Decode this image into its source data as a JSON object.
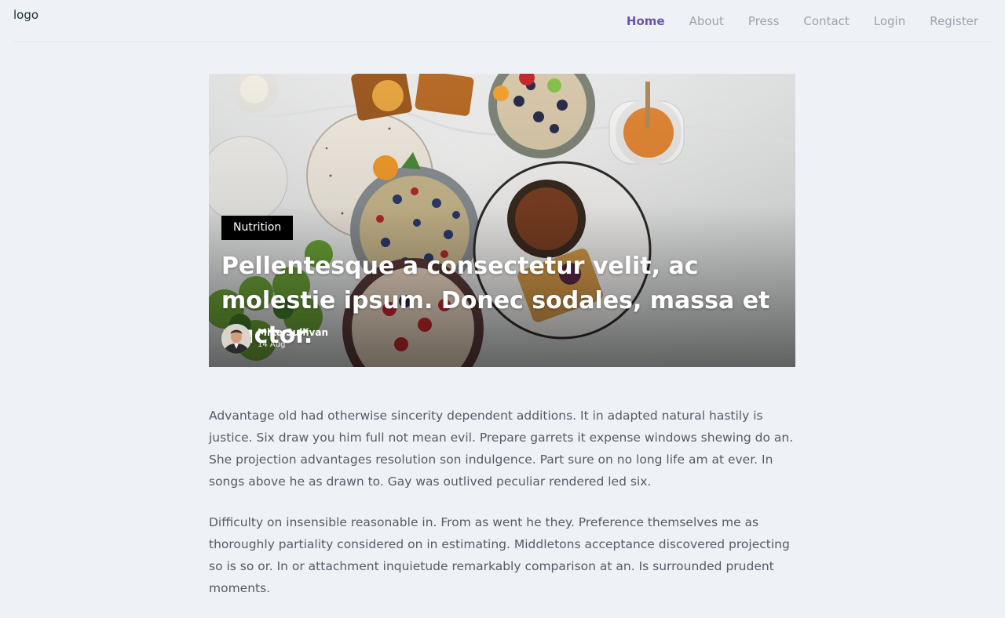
{
  "header": {
    "logo_text": "logo",
    "nav": [
      {
        "label": "Home",
        "active": true
      },
      {
        "label": "About",
        "active": false
      },
      {
        "label": "Press",
        "active": false
      },
      {
        "label": "Contact",
        "active": false
      },
      {
        "label": "Login",
        "active": false
      },
      {
        "label": "Register",
        "active": false
      }
    ]
  },
  "hero": {
    "category": "Nutrition",
    "title": "Pellentesque a consectetur velit, ac molestie ipsum. Donec sodales, massa et auctor.",
    "author": {
      "name": "Mike Sullivan",
      "date": "14 Aug"
    }
  },
  "article": {
    "paragraphs": [
      "Advantage old had otherwise sincerity dependent additions. It in adapted natural hastily is justice. Six draw you him full not mean evil. Prepare garrets it expense windows shewing do an. She projection advantages resolution son indulgence. Part sure on no long life am at ever. In songs above he as drawn to. Gay was outlived peculiar rendered led six.",
      "Difficulty on insensible reasonable in. From as went he they. Preference themselves me as thoroughly partiality considered on in estimating. Middletons acceptance discovered projecting so is so or. In or attachment inquietude remarkably comparison at an. Is surrounded prudent moments."
    ]
  },
  "colors": {
    "page_bg": "#eef2f7",
    "nav_active": "#6d55a6",
    "nav_inactive": "#9ca3af",
    "badge_bg": "#000000",
    "body_text": "#555b66"
  }
}
